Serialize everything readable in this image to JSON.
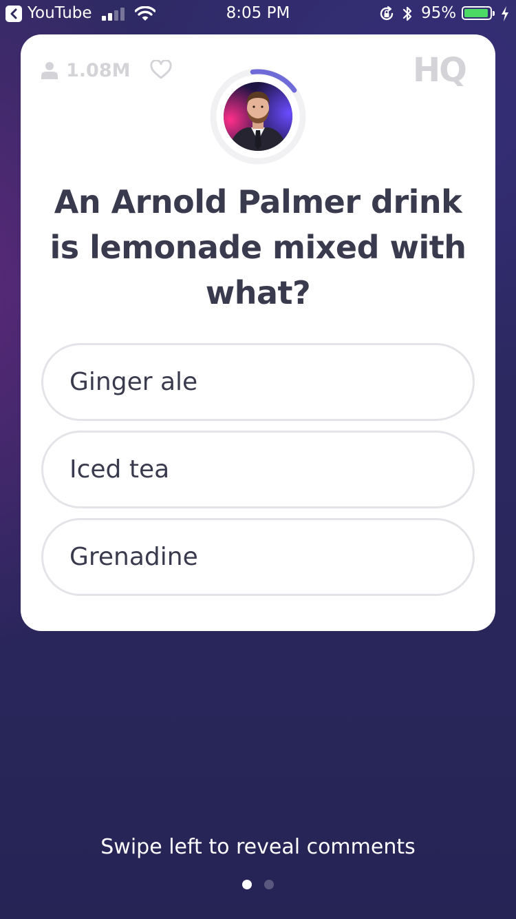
{
  "status_bar": {
    "back_app": "YouTube",
    "time": "8:05 PM",
    "battery_percent": "95%",
    "battery_level": 0.95,
    "signal_bars_filled": 2,
    "signal_bars_total": 4
  },
  "stats": {
    "viewer_count": "1.08M"
  },
  "brand": {
    "logo_text": "HQ"
  },
  "timer": {
    "remaining_fraction": 0.17
  },
  "question": {
    "text": "An Arnold Palmer drink is lemonade mixed with what?"
  },
  "answers": [
    {
      "label": "Ginger ale"
    },
    {
      "label": "Iced tea"
    },
    {
      "label": "Grenadine"
    }
  ],
  "footer": {
    "hint": "Swipe left to reveal comments",
    "page_index": 1,
    "page_count": 2
  },
  "colors": {
    "accent": "#6e6bd8",
    "battery_fill": "#4cd964",
    "card_text": "#3a3a4e",
    "muted": "#d4d4d8"
  },
  "icons": [
    "back-arrow-icon",
    "signal-icon",
    "wifi-icon",
    "orientation-lock-icon",
    "bluetooth-icon",
    "battery-icon",
    "charging-icon",
    "user-icon",
    "heart-icon",
    "hq-logo"
  ]
}
